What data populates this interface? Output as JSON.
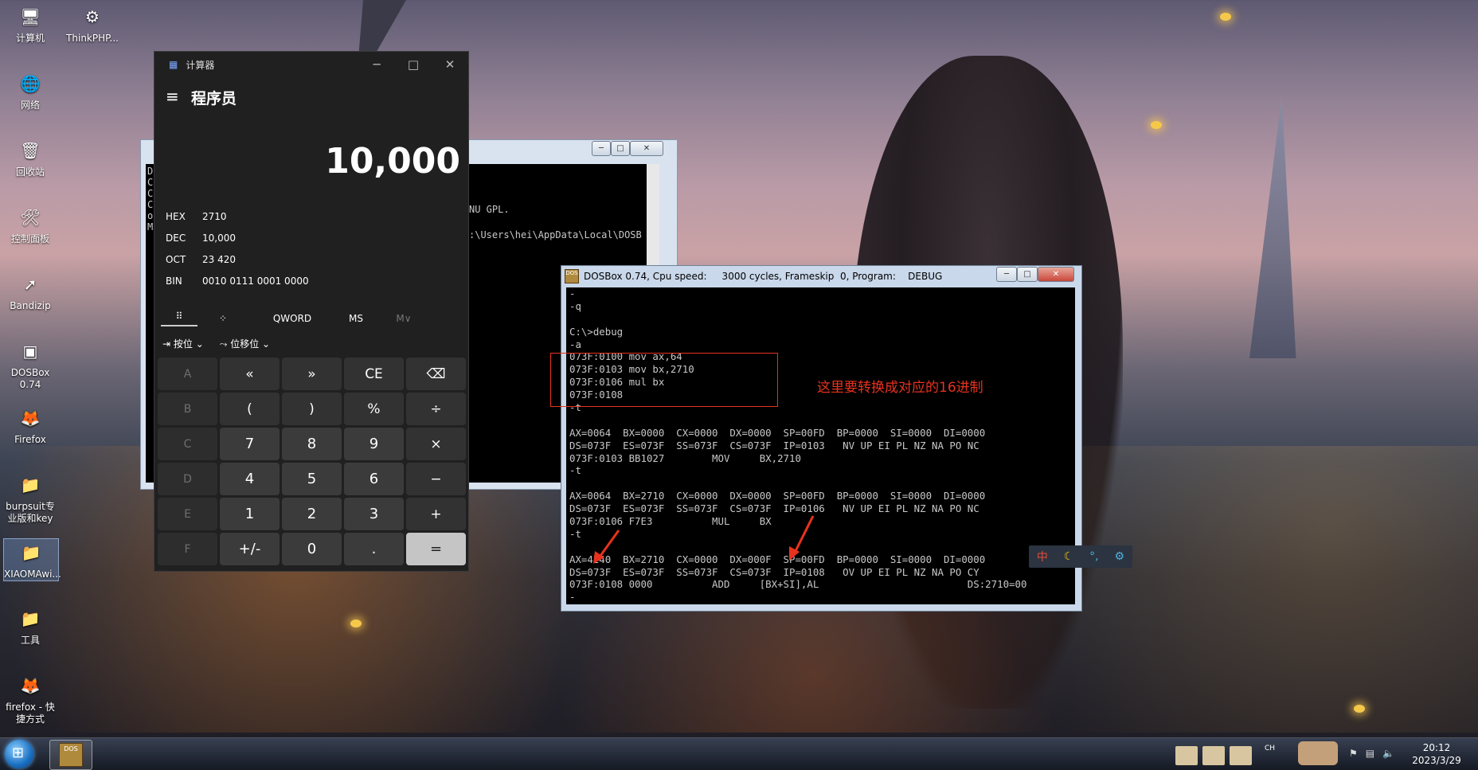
{
  "desktop": {
    "icons": [
      {
        "label": "计算机",
        "glyph": "🖥"
      },
      {
        "label": "ThinkPHP...",
        "glyph": "⚙"
      },
      {
        "label": "网络",
        "glyph": "🌐"
      },
      {
        "label": "回收站",
        "glyph": "🗑"
      },
      {
        "label": "控制面板",
        "glyph": "🛠"
      },
      {
        "label": "Bandizip",
        "glyph": "➚"
      },
      {
        "label": "DOSBox 0.74",
        "glyph": "▣"
      },
      {
        "label": "Firefox",
        "glyph": "🦊"
      },
      {
        "label": "burpsuit专业版和key",
        "glyph": "📁"
      },
      {
        "label": "XIAOMAwi...",
        "glyph": "📁"
      },
      {
        "label": "工具",
        "glyph": "📁"
      },
      {
        "label": "firefox - 快捷方式",
        "glyph": "🦊"
      }
    ]
  },
  "calculator": {
    "title": "计算器",
    "mode": "程序员",
    "display": "10,000",
    "bases": [
      {
        "name": "HEX",
        "value": "2710"
      },
      {
        "name": "DEC",
        "value": "10,000"
      },
      {
        "name": "OCT",
        "value": "23 420"
      },
      {
        "name": "BIN",
        "value": "0010 0111 0001 0000"
      }
    ],
    "toolbar": {
      "word_size": "QWORD",
      "ms": "MS",
      "mv": "M∨"
    },
    "bitwise": "按位",
    "bitshift": "位移位",
    "keys": [
      [
        "A",
        "«",
        "»",
        "CE",
        "⌫"
      ],
      [
        "B",
        "(",
        ")",
        "%",
        "÷"
      ],
      [
        "C",
        "7",
        "8",
        "9",
        "×"
      ],
      [
        "D",
        "4",
        "5",
        "6",
        "−"
      ],
      [
        "E",
        "1",
        "2",
        "3",
        "+"
      ],
      [
        "F",
        "+/-",
        "0",
        ".",
        "="
      ]
    ]
  },
  "back_window": {
    "lines": [
      "D",
      "C",
      "C",
      "C",
      "o",
      "M"
    ],
    "text1": "NU GPL.",
    "text2": ":\\Users\\hei\\AppData\\Local\\DOSB"
  },
  "dosbox": {
    "title": "DOSBox 0.74, Cpu speed:     3000 cycles, Frameskip  0, Program:    DEBUG",
    "annotation": "这里要转换成对应的16进制",
    "terminal": [
      "-",
      "-q",
      "",
      "C:\\>debug",
      "-a",
      "073F:0100 mov ax,64",
      "073F:0103 mov bx,2710",
      "073F:0106 mul bx",
      "073F:0108",
      "-t",
      "",
      "AX=0064  BX=0000  CX=0000  DX=0000  SP=00FD  BP=0000  SI=0000  DI=0000",
      "DS=073F  ES=073F  SS=073F  CS=073F  IP=0103   NV UP EI PL NZ NA PO NC",
      "073F:0103 BB1027        MOV     BX,2710",
      "-t",
      "",
      "AX=0064  BX=2710  CX=0000  DX=0000  SP=00FD  BP=0000  SI=0000  DI=0000",
      "DS=073F  ES=073F  SS=073F  CS=073F  IP=0106   NV UP EI PL NZ NA PO NC",
      "073F:0106 F7E3          MUL     BX",
      "-t",
      "",
      "AX=4240  BX=2710  CX=0000  DX=000F  SP=00FD  BP=0000  SI=0000  DI=0000",
      "DS=073F  ES=073F  SS=073F  CS=073F  IP=0108   OV UP EI PL NZ NA PO CY",
      "073F:0108 0000          ADD     [BX+SI],AL                         DS:2710=00",
      "-"
    ]
  },
  "ime": {
    "lang": "中",
    "moon": "☾",
    "punct": "°,",
    "gear": "⚙"
  },
  "taskbar": {
    "time": "20:12",
    "date": "2023/3/29",
    "tray_text": "CH"
  },
  "colors": {
    "annotation": "#e8321e",
    "calc_bg": "#202020",
    "accent": "#c5c5c5"
  }
}
